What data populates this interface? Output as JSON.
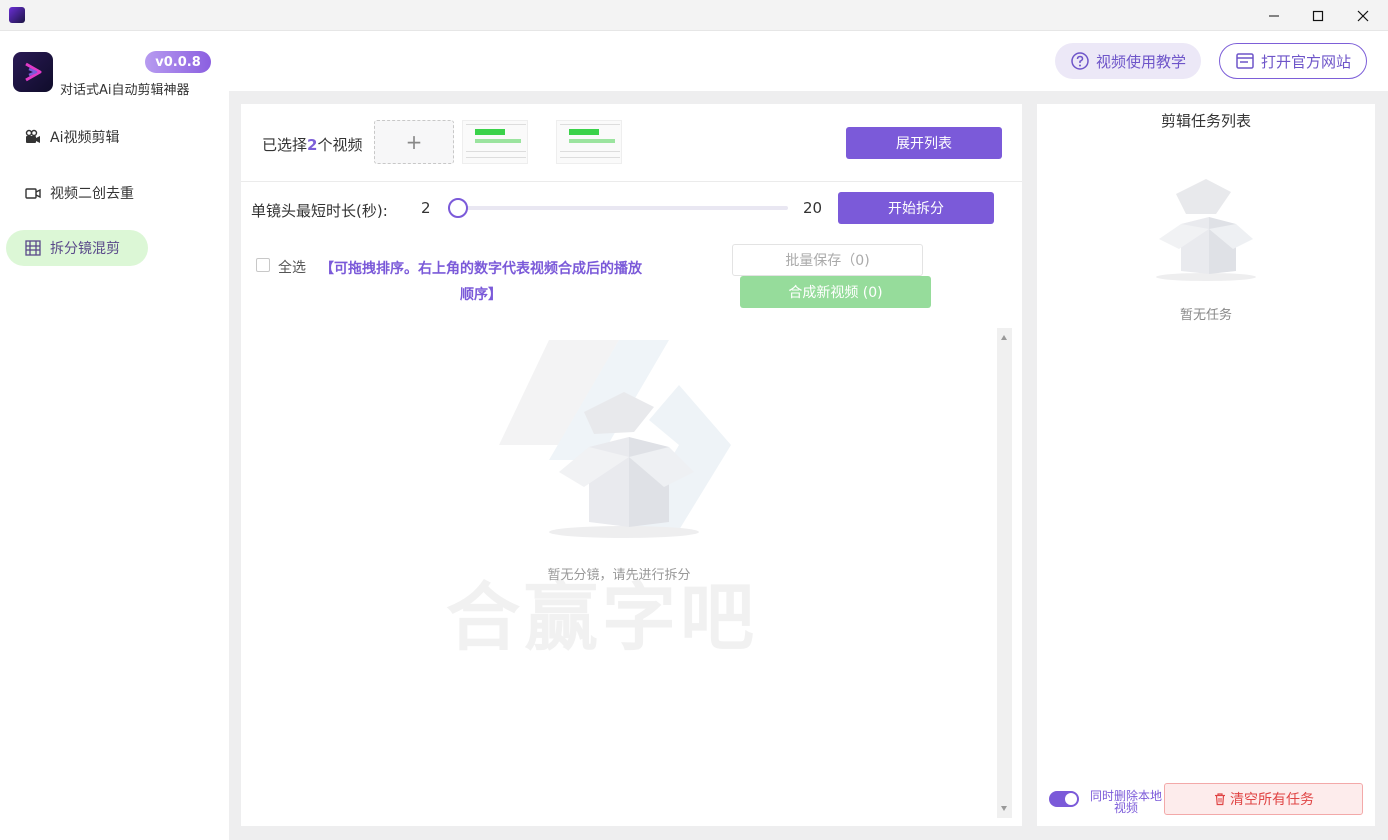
{
  "window": {
    "controls": [
      "minimize-icon",
      "maximize-icon",
      "close-icon"
    ]
  },
  "sidebar": {
    "version": "v0.0.8",
    "app_name": "对话式Ai自动剪辑神器",
    "items": [
      {
        "label": "Ai视频剪辑",
        "icon": "video-camera-icon",
        "active": false
      },
      {
        "label": "视频二创去重",
        "icon": "video-icon",
        "active": false
      },
      {
        "label": "拆分镜混剪",
        "icon": "film-grid-icon",
        "active": true
      }
    ]
  },
  "header": {
    "tutorial_label": "视频使用教学",
    "official_label": "打开官方网站"
  },
  "main": {
    "selected_prefix": "已选择",
    "selected_count": "2",
    "selected_suffix": "个视频",
    "add_symbol": "+",
    "expand_label": "展开列表",
    "slider": {
      "label": "单镜头最短时长(秒):",
      "min_label": "2",
      "max_label": "20",
      "min": 2,
      "max": 20,
      "value": 2
    },
    "split_label": "开始拆分",
    "select_all_label": "全选",
    "hint": "【可拖拽排序。右上角的数字代表视频合成后的播放顺序】",
    "batch_save_label": "批量保存（0)",
    "merge_label": "合成新视频 (0)",
    "empty_text": "暂无分镜，请先进行拆分",
    "watermark": "合赢字吧"
  },
  "tasks": {
    "title": "剪辑任务列表",
    "empty_text": "暂无任务",
    "toggle_label": "同时删除本地视频",
    "toggle_on": true,
    "clear_label": "清空所有任务"
  },
  "colors": {
    "accent": "#7b5ad9",
    "active_nav_bg": "#dcf7d6",
    "merge_green": "#96dc9b",
    "danger": "#e04545"
  }
}
